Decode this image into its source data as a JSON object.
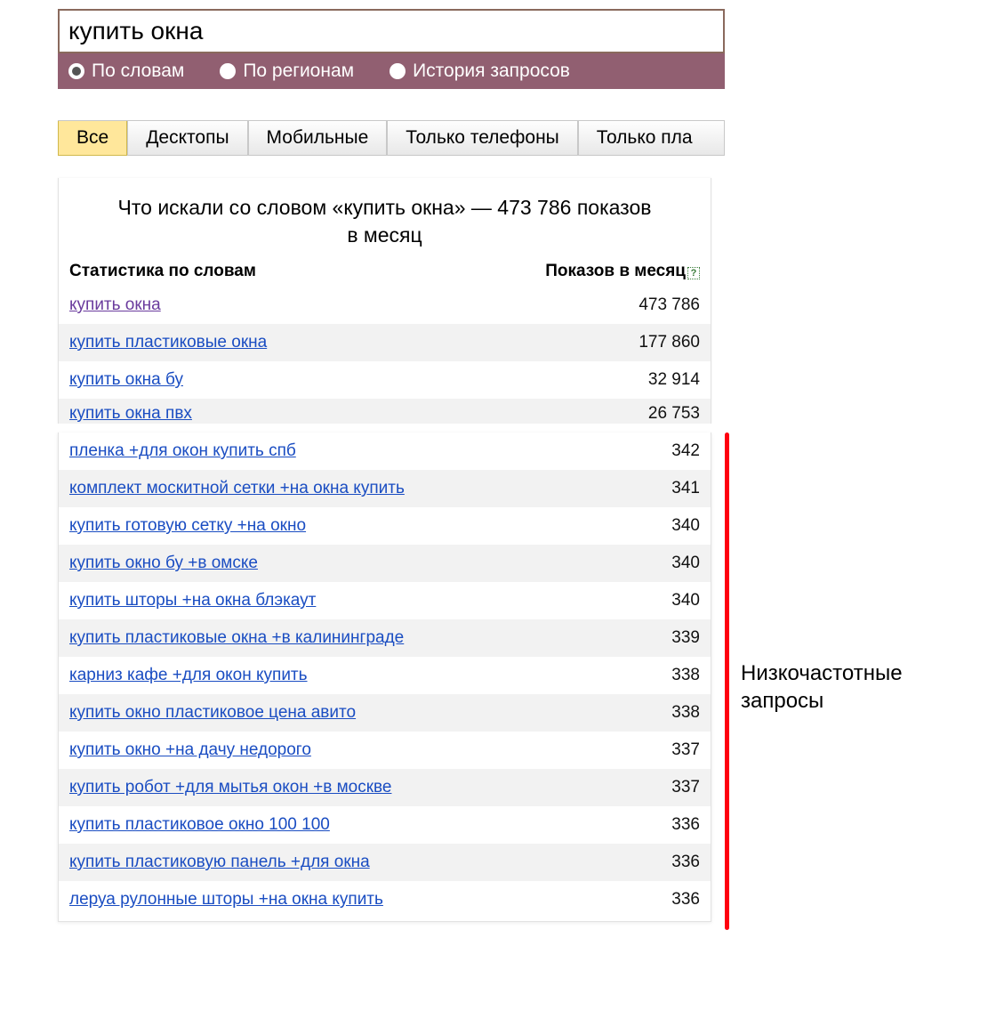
{
  "search_value": "купить окна",
  "radios": [
    {
      "label": "По словам",
      "selected": true
    },
    {
      "label": "По регионам",
      "selected": false
    },
    {
      "label": "История запросов",
      "selected": false
    }
  ],
  "tabs": [
    {
      "label": "Все",
      "active": true
    },
    {
      "label": "Десктопы",
      "active": false
    },
    {
      "label": "Мобильные",
      "active": false
    },
    {
      "label": "Только телефоны",
      "active": false
    },
    {
      "label": "Только пла",
      "active": false
    }
  ],
  "panel_title": "Что искали со словом «купить окна» — 473 786 показов в месяц",
  "col1": "Статистика по словам",
  "col2": "Показов в месяц",
  "top_rows": [
    {
      "query": "купить окна",
      "count": "473 786",
      "visited": true
    },
    {
      "query": "купить пластиковые окна",
      "count": "177 860",
      "visited": false
    },
    {
      "query": "купить окна бу",
      "count": "32 914",
      "visited": false
    },
    {
      "query": "купить окна пвх",
      "count": "26 753",
      "visited": false
    }
  ],
  "low_rows": [
    {
      "query": "пленка +для окон купить спб",
      "count": "342"
    },
    {
      "query": "комплект москитной сетки +на окна купить",
      "count": "341"
    },
    {
      "query": "купить готовую сетку +на окно",
      "count": "340"
    },
    {
      "query": "купить окно бу +в омске",
      "count": "340"
    },
    {
      "query": "купить шторы +на окна блэкаут",
      "count": "340"
    },
    {
      "query": "купить пластиковые окна +в калининграде",
      "count": "339"
    },
    {
      "query": "карниз кафе +для окон купить",
      "count": "338"
    },
    {
      "query": "купить окно пластиковое цена авито",
      "count": "338"
    },
    {
      "query": "купить окно +на дачу недорого",
      "count": "337"
    },
    {
      "query": "купить робот +для мытья окон +в москве",
      "count": "337"
    },
    {
      "query": "купить пластиковое окно 100 100",
      "count": "336"
    },
    {
      "query": "купить пластиковую панель +для окна",
      "count": "336"
    },
    {
      "query": "леруа рулонные шторы +на окна купить",
      "count": "336"
    }
  ],
  "annotation_line1": "Низкочастотные",
  "annotation_line2": "запросы"
}
